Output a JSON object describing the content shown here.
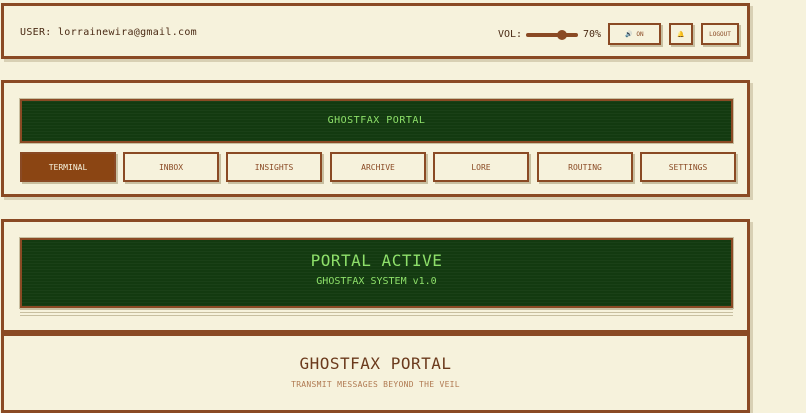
{
  "header": {
    "user_label": "USER: lorrainewira@gmail.com",
    "volume_label": "VOL:",
    "volume_value": "70%",
    "volume_fraction": 0.7,
    "sound_button": {
      "icon": "speaker-icon",
      "label": "🔊 ON"
    },
    "alert_button": {
      "icon": "bell-icon",
      "label": "🔔"
    },
    "logout_label": "LOGOUT"
  },
  "nav": {
    "title": "GHOSTFAX PORTAL",
    "tabs": [
      {
        "label": "TERMINAL",
        "active": true
      },
      {
        "label": "INBOX",
        "active": false
      },
      {
        "label": "INSIGHTS",
        "active": false
      },
      {
        "label": "ARCHIVE",
        "active": false
      },
      {
        "label": "LORE",
        "active": false
      },
      {
        "label": "ROUTING",
        "active": false
      },
      {
        "label": "SETTINGS",
        "active": false
      }
    ]
  },
  "status": {
    "main": "PORTAL ACTIVE",
    "sub": "GHOSTFAX SYSTEM v1.0"
  },
  "intro": {
    "title": "GHOSTFAX PORTAL",
    "subtitle": "TRANSMIT MESSAGES BEYOND THE VEIL"
  },
  "colors": {
    "accent": "#8b4513",
    "screen_bg": "#133a10",
    "screen_text": "#8ee06a",
    "page_bg": "#f6f2dc"
  }
}
